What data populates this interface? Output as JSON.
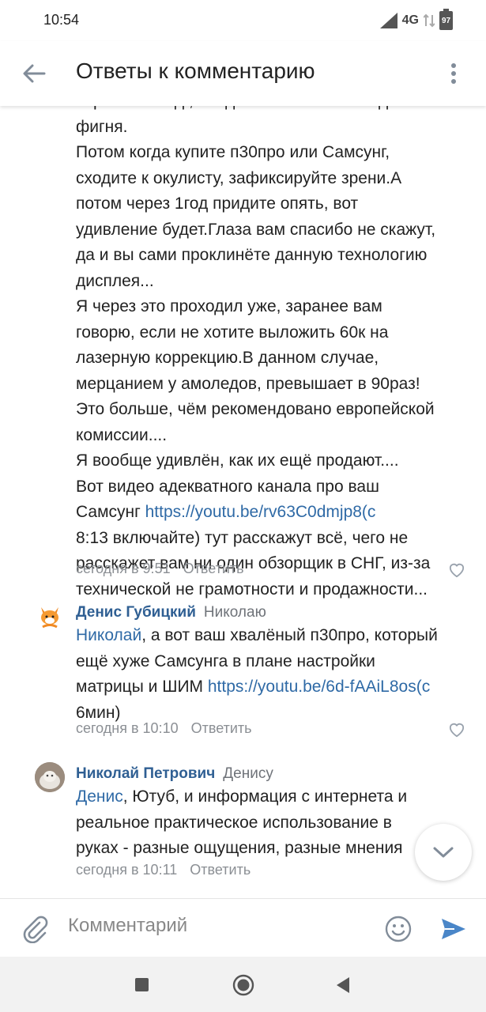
{
  "status_bar": {
    "time": "10:54",
    "network": "4G",
    "battery": "97"
  },
  "header": {
    "title": "Ответы к комментарию"
  },
  "first_comment": {
    "lines": [
      "хорошим и т.д., а в действии на самом деле",
      "фигня.",
      "Потом когда купите п30про или Самсунг,",
      "сходите к окулисту, зафиксируйте зрени.А",
      "потом через 1год придите опять, вот",
      "удивление будет.Глаза вам спасибо не скажут,",
      "да и вы сами проклинёте данную технологию",
      "дисплея...",
      "Я через это проходил уже, заранее вам",
      "говорю, если не хотите выложить 60к на",
      "лазерную коррекцию.В данном случае,",
      "мерцанием у амоледов, превышает в 90раз!",
      "Это больше, чём рекомендовано европейской",
      "комиссии....",
      "Я вообще удивлён, как их ещё продают....",
      "Вот видео адекватного канала про ваш"
    ],
    "link_prefix": "Самсунг ",
    "link": "https://youtu.be/rv63C0dmjp8(с",
    "tail_lines": [
      "8:13 включайте) тут расскажут всё, чего не",
      "расскажет вам ни один обзорщик в СНГ, из-за",
      "технической не грамотности и продажности..."
    ],
    "time": "сегодня в 9:51",
    "reply_label": "Ответить"
  },
  "comments": [
    {
      "author": "Денис Губицкий",
      "reply_to": "Николаю",
      "mention": "Николай",
      "line1_rest": ", а вот ваш хвалёный п30про, который",
      "line2": "ещё хуже Самсунга в плане настройки",
      "line3_prefix": "матрицы и ШИМ ",
      "link": "https://youtu.be/6d-fAAiL8os(с",
      "line4": "6мин)",
      "time": "сегодня в 10:10",
      "reply_label": "Ответить"
    },
    {
      "author": "Николай Петрович",
      "reply_to": "Денису",
      "mention": "Денис",
      "line1_rest": ", Ютуб, и информация с интернета и",
      "line2": "реальное практическое использование в",
      "line3": "руках - разные ощущения, разные мнения",
      "time": "сегодня в 10:11",
      "reply_label": "Ответить"
    }
  ],
  "composer": {
    "placeholder": "Комментарий"
  },
  "colors": {
    "link": "#2f6aa6",
    "author": "#2f5f93",
    "accent": "#4a86c8",
    "meta": "#8b8f94"
  },
  "icons": [
    "arrow-back-icon",
    "more-vert-icon",
    "heart-icon",
    "chevron-down-icon",
    "paperclip-icon",
    "smile-icon",
    "send-icon"
  ]
}
